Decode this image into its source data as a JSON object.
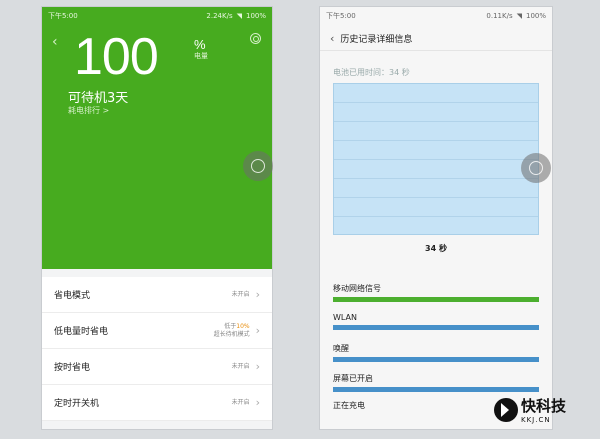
{
  "left": {
    "status": {
      "time": "下午5:00",
      "speed": "2.24K/s",
      "battery": "100%"
    },
    "battery_percent": "100",
    "percent_sign": "%",
    "percent_label": "电量",
    "standby": "可待机3天",
    "rank_link": "耗电排行 >",
    "rows": [
      {
        "label": "省电模式",
        "value_line1": "未开启",
        "value_line2": ""
      },
      {
        "label": "低电量时省电",
        "value_prefix": "低于",
        "value_highlight": "10%",
        "value_line2": "超长待机模式"
      },
      {
        "label": "按时省电",
        "value_line1": "未开启",
        "value_line2": ""
      },
      {
        "label": "定时开关机",
        "value_line1": "未开启",
        "value_line2": ""
      }
    ],
    "accent_color": "#47ab1f"
  },
  "right": {
    "status": {
      "time": "下午5:00",
      "speed": "0.11K/s",
      "battery": "100%"
    },
    "title": "历史记录详细信息",
    "used_time": "电池已用时间：34 秒",
    "chart_caption": "34 秒",
    "stats": [
      {
        "name": "移动网络信号",
        "color": "green"
      },
      {
        "name": "WLAN",
        "color": "blue"
      },
      {
        "name": "唤醒",
        "color": "blue"
      },
      {
        "name": "屏幕已开启",
        "color": "blue"
      }
    ],
    "charging": "正在充电"
  },
  "watermark": {
    "cn": "快科技",
    "en": "KKJ.CN"
  }
}
